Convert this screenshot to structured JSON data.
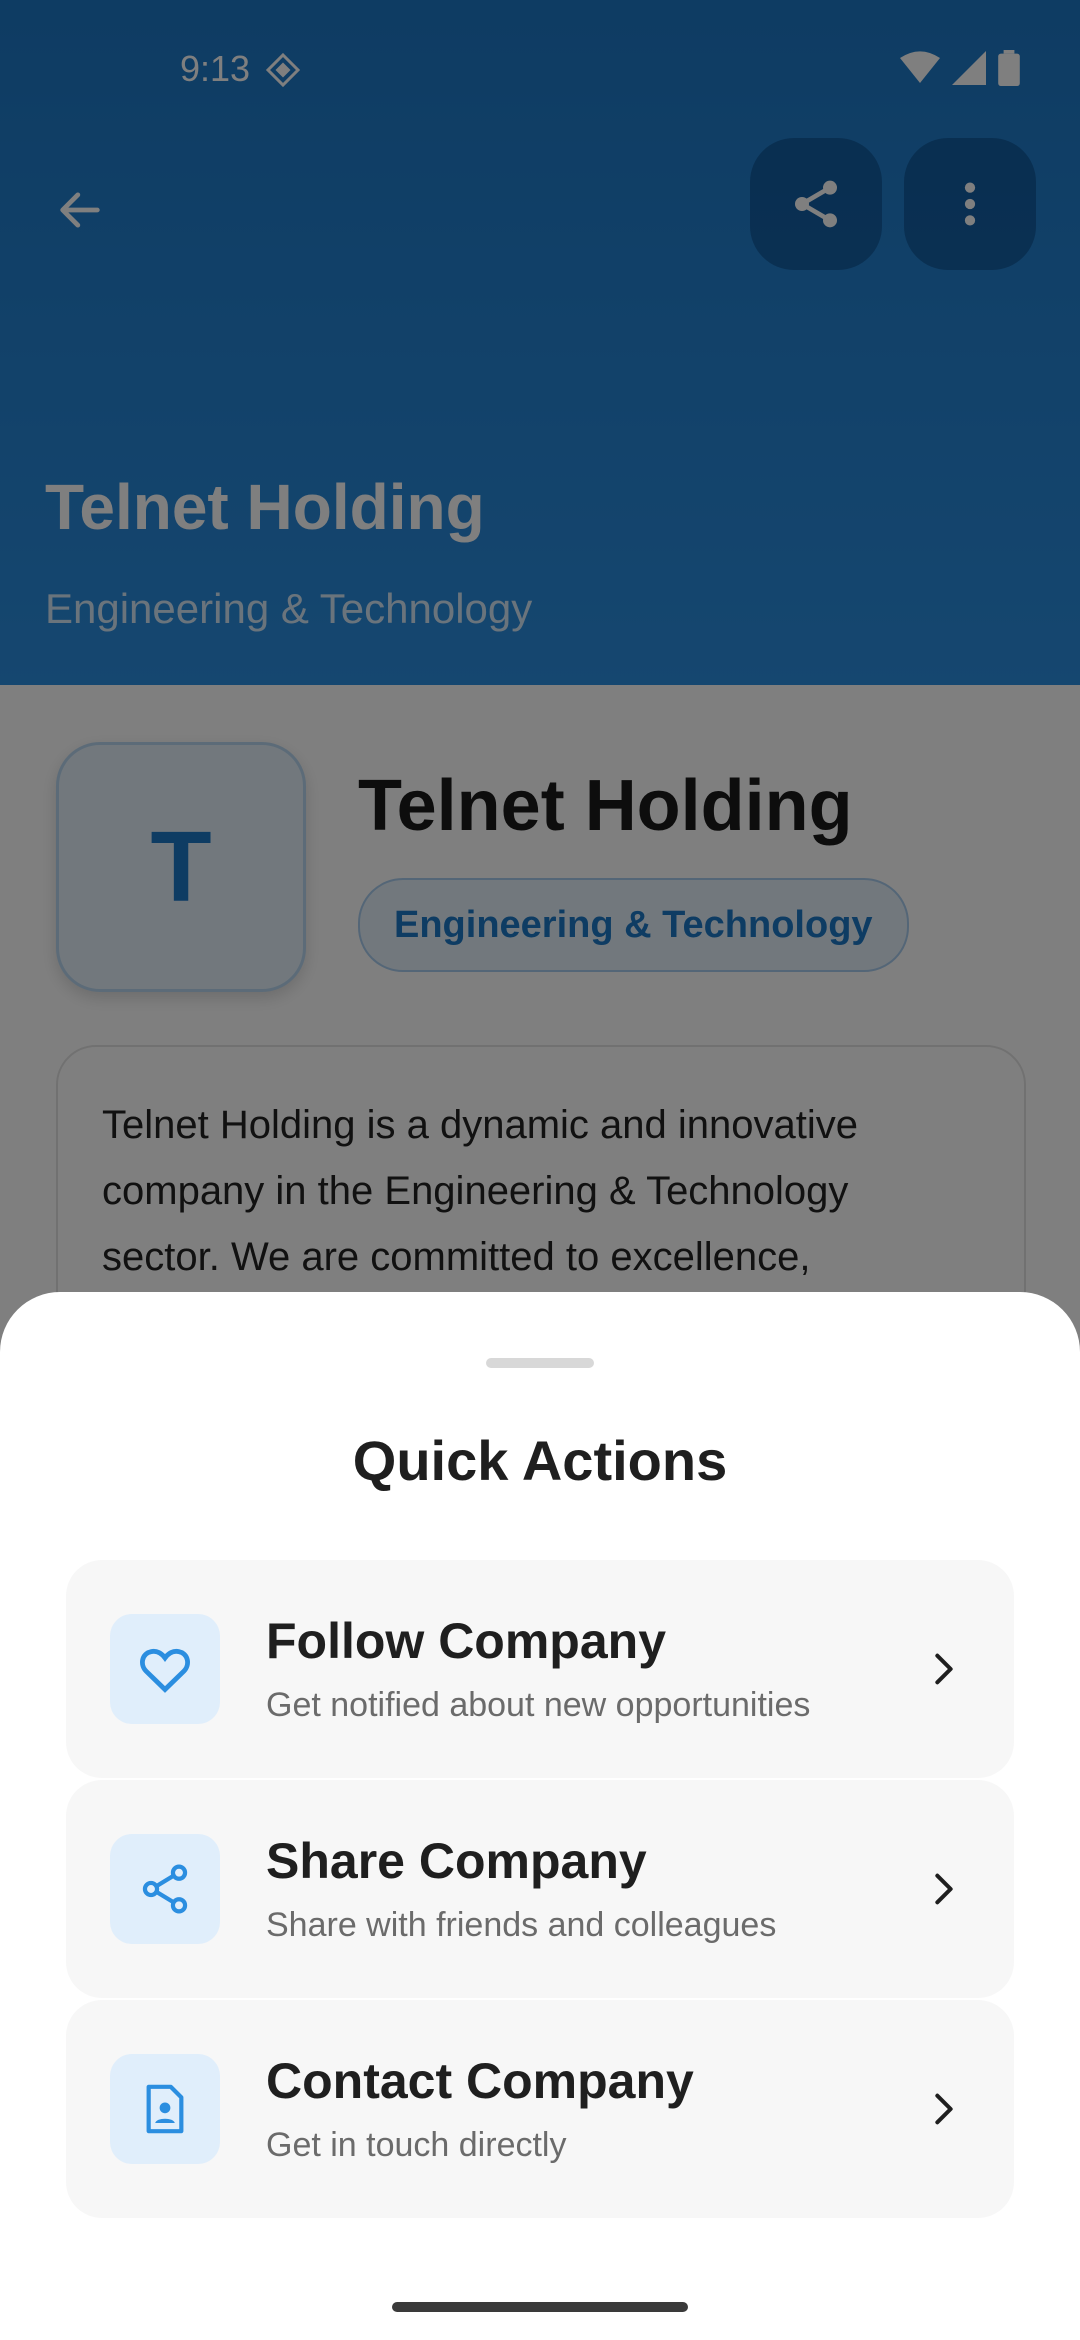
{
  "status_bar": {
    "time": "9:13"
  },
  "header": {
    "title": "Telnet Holding",
    "subtitle": "Engineering & Technology",
    "accent": "#1d78c6"
  },
  "profile": {
    "logo_letter": "T",
    "name": "Telnet Holding",
    "category_chip": "Engineering & Technology",
    "description": "Telnet Holding is a dynamic and innovative company in the Engineering & Technology sector. We are committed to excellence,"
  },
  "sheet": {
    "title": "Quick Actions",
    "actions": [
      {
        "title": "Follow Company",
        "subtitle": "Get notified about new opportunities",
        "icon": "heart-icon"
      },
      {
        "title": "Share Company",
        "subtitle": "Share with friends and colleagues",
        "icon": "share-icon"
      },
      {
        "title": "Contact Company",
        "subtitle": "Get in touch directly",
        "icon": "contact-icon"
      }
    ]
  }
}
